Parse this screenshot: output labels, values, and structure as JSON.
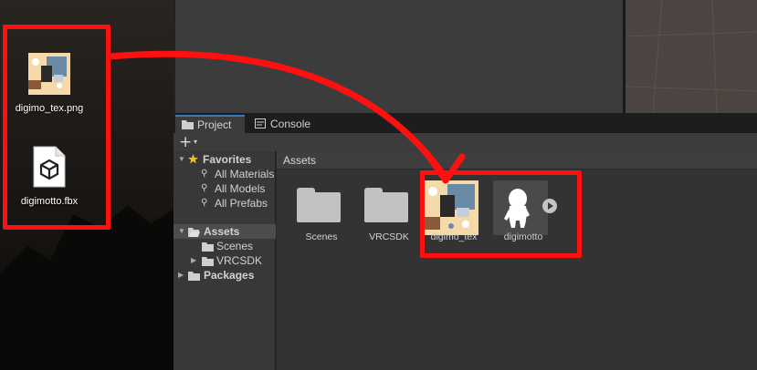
{
  "desktop": {
    "icons": [
      {
        "label": "digimo_tex.png",
        "icon": "image-icon"
      },
      {
        "label": "digimotto.fbx",
        "icon": "fbx-file-icon"
      }
    ]
  },
  "project_panel": {
    "tabs": [
      {
        "label": "Project",
        "icon": "folder-icon",
        "active": true
      },
      {
        "label": "Console",
        "icon": "console-icon",
        "active": false
      }
    ],
    "toolbar": {
      "add_label": "+",
      "add_caret": "▾"
    },
    "tree": {
      "favorites": {
        "label": "Favorites",
        "items": [
          "All Materials",
          "All Models",
          "All Prefabs"
        ]
      },
      "assets": {
        "label": "Assets",
        "children": [
          "Scenes",
          "VRCSDK"
        ]
      },
      "packages": {
        "label": "Packages"
      }
    },
    "breadcrumb": "Assets",
    "assets": [
      {
        "label": "Scenes",
        "type": "folder"
      },
      {
        "label": "VRCSDK",
        "type": "folder"
      },
      {
        "label": "digimo_tex",
        "type": "texture"
      },
      {
        "label": "digimotto",
        "type": "model"
      }
    ]
  },
  "colors": {
    "annotation_red": "#ff1010",
    "tab_accent": "#3a79bb",
    "folder_gray": "#c2c2c2",
    "favorites_star": "#f0c020"
  }
}
